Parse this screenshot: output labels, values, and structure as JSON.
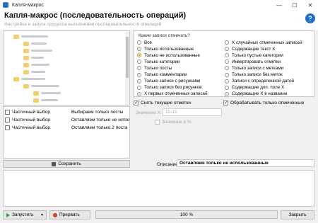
{
  "window": {
    "title": "Капля-макрос",
    "minimize": "—",
    "maximize": "☐",
    "close": "✕"
  },
  "header": {
    "title": "Капля-макрос (последовательность операций)",
    "subtitle": "Настройка и запуск процесса выполнения последовательности операций",
    "help": "?"
  },
  "operations": [
    {
      "type": "Частичный выбор",
      "description": "Выбираем только посты"
    },
    {
      "type": "Частичный выбор",
      "description": "Оставляем только не использ"
    },
    {
      "type": "Частичный выбор",
      "description": "Оставляем только 2 поста"
    }
  ],
  "save_button": "Сохранить",
  "filter": {
    "title": "Какие записи отмечать?",
    "selected": "Только не использованные",
    "left_options": [
      "Все",
      "Только использованные",
      "Только не использованные",
      "Только категории",
      "Только посты",
      "Только комментарии",
      "Только записи с рисунками",
      "Только записи без рисунков",
      "X первых отмеченных записей"
    ],
    "right_options": [
      "X случайных отмеченных записей",
      "Содержащие текст X",
      "Только пустые категории",
      "Инвертировать отметки",
      "Только записи с метками",
      "Только записи без меток",
      "Записи с определенной датой",
      "Содержащие доп. поле X",
      "Содержащие X в названии"
    ]
  },
  "options": {
    "clear_marks": {
      "label": "Снять текущие отметки",
      "checked": true
    },
    "process_marked": {
      "label": "Обрабатывать только отмеченные",
      "checked": true
    },
    "value_label": "Значение X:",
    "value": "10-15",
    "percent": {
      "label": "Значение в %",
      "checked": false
    }
  },
  "description": {
    "label": "Описание:",
    "value": "Оставляем только не использованные"
  },
  "bottom": {
    "run": "Запустить",
    "abort": "Прервать",
    "progress_text": "100 %",
    "progress": 1.0,
    "close": "Закрыть"
  }
}
